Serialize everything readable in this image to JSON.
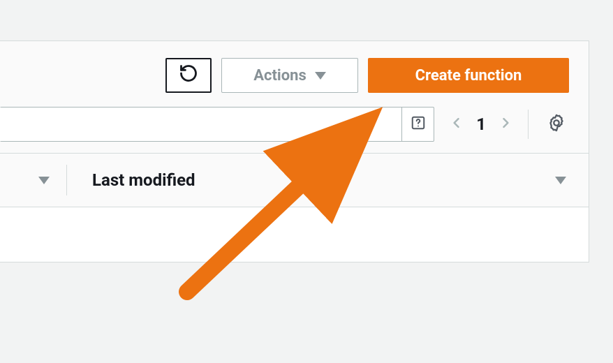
{
  "toolbar": {
    "actions_label": "Actions",
    "create_label": "Create function"
  },
  "filter": {
    "search_placeholder": ""
  },
  "pagination": {
    "current_page": "1"
  },
  "columns": {
    "last_modified": "Last modified"
  },
  "colors": {
    "primary": "#ec7211",
    "arrow": "#ec7211"
  }
}
